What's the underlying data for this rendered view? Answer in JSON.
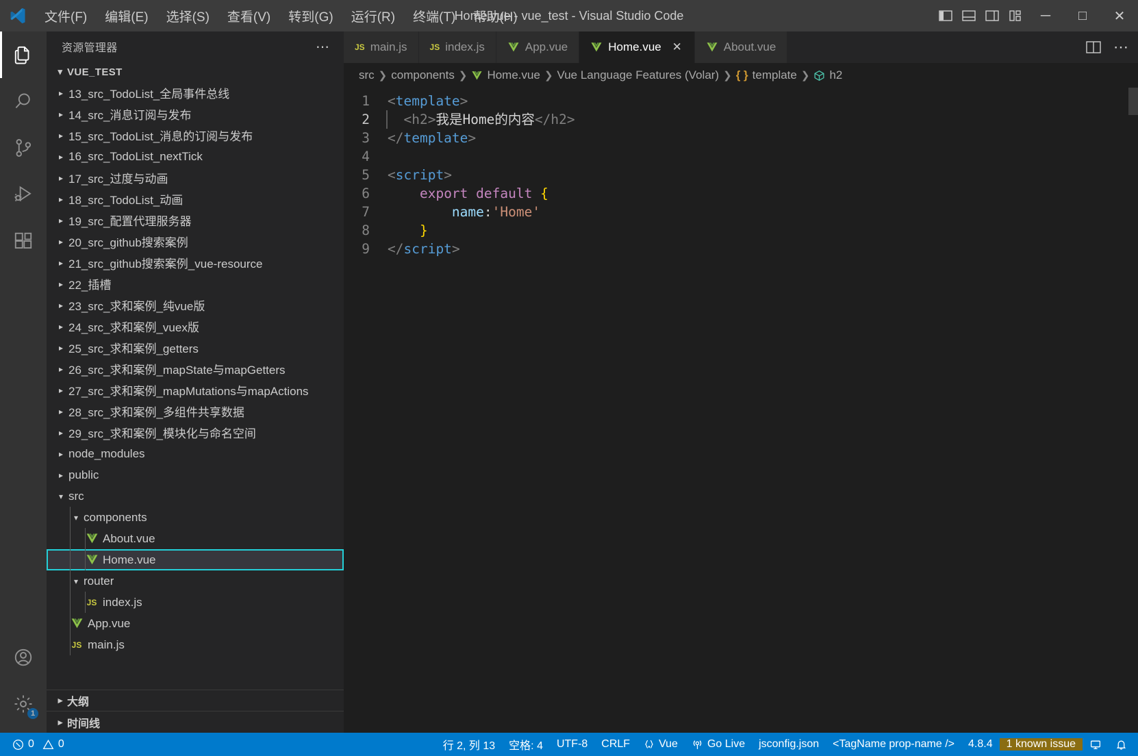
{
  "titlebar": {
    "logo_icon": "vscode-logo-icon",
    "title": "Home.vue - vue_test - Visual Studio Code",
    "menus": [
      {
        "label": "文件(F)",
        "name": "menu-file"
      },
      {
        "label": "编辑(E)",
        "name": "menu-edit"
      },
      {
        "label": "选择(S)",
        "name": "menu-selection"
      },
      {
        "label": "查看(V)",
        "name": "menu-view"
      },
      {
        "label": "转到(G)",
        "name": "menu-go"
      },
      {
        "label": "运行(R)",
        "name": "menu-run"
      },
      {
        "label": "终端(T)",
        "name": "menu-terminal"
      },
      {
        "label": "帮助(H)",
        "name": "menu-help"
      }
    ],
    "layout_buttons": [
      {
        "icon": "toggle-primary-sidebar-icon"
      },
      {
        "icon": "toggle-panel-icon"
      },
      {
        "icon": "toggle-secondary-sidebar-icon"
      },
      {
        "icon": "customize-layout-icon"
      }
    ],
    "window_buttons": {
      "minimize": "─",
      "maximize": "□",
      "close": "✕"
    }
  },
  "activitybar": {
    "items": [
      {
        "name": "activity-explorer",
        "icon": "files-icon",
        "active": true
      },
      {
        "name": "activity-search",
        "icon": "search-icon",
        "active": false
      },
      {
        "name": "activity-source-control",
        "icon": "source-control-icon",
        "active": false
      },
      {
        "name": "activity-run-debug",
        "icon": "run-and-debug-icon",
        "active": false
      },
      {
        "name": "activity-extensions",
        "icon": "extensions-icon",
        "active": false
      }
    ],
    "bottom": [
      {
        "name": "activity-accounts",
        "icon": "account-icon",
        "badge": ""
      },
      {
        "name": "activity-settings",
        "icon": "gear-icon",
        "badge": "1"
      }
    ]
  },
  "sidebar": {
    "title": "资源管理器",
    "actions_icon": "ellipsis-icon",
    "root": {
      "label": "VUE_TEST",
      "expanded": true
    },
    "tree": [
      {
        "label": "13_src_TodoList_全局事件总线",
        "depth": 1,
        "type": "folder",
        "expanded": false
      },
      {
        "label": "14_src_消息订阅与发布",
        "depth": 1,
        "type": "folder",
        "expanded": false
      },
      {
        "label": "15_src_TodoList_消息的订阅与发布",
        "depth": 1,
        "type": "folder",
        "expanded": false
      },
      {
        "label": "16_src_TodoList_nextTick",
        "depth": 1,
        "type": "folder",
        "expanded": false
      },
      {
        "label": "17_src_过度与动画",
        "depth": 1,
        "type": "folder",
        "expanded": false
      },
      {
        "label": "18_src_TodoList_动画",
        "depth": 1,
        "type": "folder",
        "expanded": false
      },
      {
        "label": "19_src_配置代理服务器",
        "depth": 1,
        "type": "folder",
        "expanded": false
      },
      {
        "label": "20_src_github搜索案例",
        "depth": 1,
        "type": "folder",
        "expanded": false
      },
      {
        "label": "21_src_github搜索案例_vue-resource",
        "depth": 1,
        "type": "folder",
        "expanded": false
      },
      {
        "label": "22_插槽",
        "depth": 1,
        "type": "folder",
        "expanded": false
      },
      {
        "label": "23_src_求和案例_纯vue版",
        "depth": 1,
        "type": "folder",
        "expanded": false
      },
      {
        "label": "24_src_求和案例_vuex版",
        "depth": 1,
        "type": "folder",
        "expanded": false
      },
      {
        "label": "25_src_求和案例_getters",
        "depth": 1,
        "type": "folder",
        "expanded": false
      },
      {
        "label": "26_src_求和案例_mapState与mapGetters",
        "depth": 1,
        "type": "folder",
        "expanded": false
      },
      {
        "label": "27_src_求和案例_mapMutations与mapActions",
        "depth": 1,
        "type": "folder",
        "expanded": false
      },
      {
        "label": "28_src_求和案例_多组件共享数据",
        "depth": 1,
        "type": "folder",
        "expanded": false
      },
      {
        "label": "29_src_求和案例_模块化与命名空间",
        "depth": 1,
        "type": "folder",
        "expanded": false
      },
      {
        "label": "node_modules",
        "depth": 1,
        "type": "folder",
        "expanded": false
      },
      {
        "label": "public",
        "depth": 1,
        "type": "folder",
        "expanded": false
      },
      {
        "label": "src",
        "depth": 1,
        "type": "folder",
        "expanded": true
      },
      {
        "label": "components",
        "depth": 2,
        "type": "folder",
        "expanded": true
      },
      {
        "label": "About.vue",
        "depth": 3,
        "type": "vue"
      },
      {
        "label": "Home.vue",
        "depth": 3,
        "type": "vue",
        "selected": true
      },
      {
        "label": "router",
        "depth": 2,
        "type": "folder",
        "expanded": true
      },
      {
        "label": "index.js",
        "depth": 3,
        "type": "js"
      },
      {
        "label": "App.vue",
        "depth": 2,
        "type": "vue"
      },
      {
        "label": "main.js",
        "depth": 2,
        "type": "js"
      }
    ],
    "bottom_sections": [
      {
        "label": "大纲",
        "name": "section-outline"
      },
      {
        "label": "时间线",
        "name": "section-timeline"
      }
    ]
  },
  "editor": {
    "tabs": [
      {
        "label": "main.js",
        "icon": "js",
        "active": false,
        "dirty": false
      },
      {
        "label": "index.js",
        "icon": "js",
        "active": false,
        "dirty": false
      },
      {
        "label": "App.vue",
        "icon": "vue",
        "active": false,
        "dirty": false
      },
      {
        "label": "Home.vue",
        "icon": "vue",
        "active": true,
        "close": "✕"
      },
      {
        "label": "About.vue",
        "icon": "vue",
        "active": false,
        "dirty": false
      }
    ],
    "tab_actions": [
      {
        "name": "split-editor-right-button",
        "icon": "split-editor-icon"
      },
      {
        "name": "editor-more-actions-button",
        "icon": "ellipsis-icon"
      }
    ],
    "breadcrumb": [
      {
        "label": "src",
        "kind": ""
      },
      {
        "label": "components",
        "kind": ""
      },
      {
        "label": "Home.vue",
        "kind": "vue"
      },
      {
        "label": "Vue Language Features (Volar)",
        "kind": ""
      },
      {
        "label": "template",
        "kind": "braces"
      },
      {
        "label": "h2",
        "kind": "symbol"
      }
    ],
    "code_lines": [
      {
        "num": "1",
        "tokens": [
          {
            "t": "<",
            "c": "tagpunct"
          },
          {
            "t": "template",
            "c": "tag"
          },
          {
            "t": ">",
            "c": "tagpunct"
          }
        ]
      },
      {
        "num": "2",
        "current": true,
        "tokens": [
          {
            "t": "  ",
            "c": "text"
          },
          {
            "t": "<h2>",
            "c": "tagpunct"
          },
          {
            "t": "我是Home的内容",
            "c": "text"
          },
          {
            "t": "</h2>",
            "c": "tagpunct"
          }
        ]
      },
      {
        "num": "3",
        "tokens": [
          {
            "t": "</",
            "c": "tagpunct"
          },
          {
            "t": "template",
            "c": "tag"
          },
          {
            "t": ">",
            "c": "tagpunct"
          }
        ]
      },
      {
        "num": "4",
        "tokens": []
      },
      {
        "num": "5",
        "tokens": [
          {
            "t": "<",
            "c": "tagpunct"
          },
          {
            "t": "script",
            "c": "tag"
          },
          {
            "t": ">",
            "c": "tagpunct"
          }
        ]
      },
      {
        "num": "6",
        "tokens": [
          {
            "t": "    ",
            "c": "text"
          },
          {
            "t": "export",
            "c": "kw"
          },
          {
            "t": " ",
            "c": "text"
          },
          {
            "t": "default",
            "c": "kw"
          },
          {
            "t": " ",
            "c": "text"
          },
          {
            "t": "{",
            "c": "brace"
          }
        ]
      },
      {
        "num": "7",
        "tokens": [
          {
            "t": "        ",
            "c": "text"
          },
          {
            "t": "name",
            "c": "prop"
          },
          {
            "t": ":",
            "c": "punct"
          },
          {
            "t": "'Home'",
            "c": "str"
          }
        ]
      },
      {
        "num": "8",
        "tokens": [
          {
            "t": "    ",
            "c": "text"
          },
          {
            "t": "}",
            "c": "brace"
          }
        ]
      },
      {
        "num": "9",
        "tokens": [
          {
            "t": "</",
            "c": "tagpunct"
          },
          {
            "t": "script",
            "c": "tag"
          },
          {
            "t": ">",
            "c": "tagpunct"
          }
        ]
      }
    ]
  },
  "statusbar": {
    "left": [
      {
        "name": "status-errors-warnings",
        "icon": "error-warning-icon",
        "label": "0",
        "label2": "0"
      }
    ],
    "right": [
      {
        "name": "status-cursor-position",
        "label": "行 2, 列 13"
      },
      {
        "name": "status-indentation",
        "label": "空格: 4"
      },
      {
        "name": "status-encoding",
        "label": "UTF-8"
      },
      {
        "name": "status-eol",
        "label": "CRLF"
      },
      {
        "name": "status-language-mode",
        "label": "Vue",
        "icon": "braces-icon"
      },
      {
        "name": "status-go-live",
        "label": "Go Live",
        "icon": "broadcast-icon"
      },
      {
        "name": "status-jsconfig",
        "label": "jsconfig.json"
      },
      {
        "name": "status-tagname",
        "label": "<TagName prop-name />"
      },
      {
        "name": "status-version",
        "label": "4.8.4"
      },
      {
        "name": "status-known-issue",
        "label": "1 known issue",
        "highlight": "#8a6d12"
      },
      {
        "name": "status-remote-host",
        "icon": "remote-icon"
      },
      {
        "name": "status-notifications",
        "icon": "bell-icon"
      }
    ]
  },
  "colors": {
    "accent_statusbar": "#007acc",
    "selection_outline": "#24d0d8",
    "vue_green": "#8dc149",
    "js_yellow": "#cbcb41",
    "known_issue_bg": "#8a6d12"
  }
}
